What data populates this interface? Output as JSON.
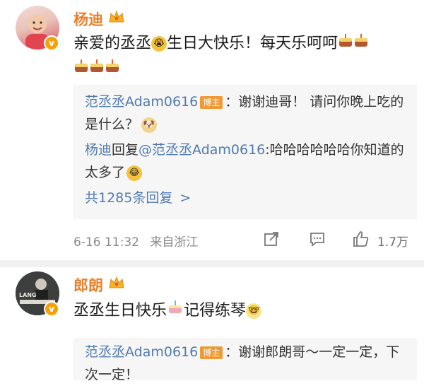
{
  "comments": [
    {
      "username": "杨迪",
      "text_a": "亲爱的丞丞",
      "text_b": "生日大快乐！每天乐呵呵",
      "replies": [
        {
          "author": "范丞丞Adam0616",
          "badge": "博主",
          "text": "：谢谢迪哥！ 请问你晚上吃的是什么？"
        },
        {
          "author": "杨迪",
          "reply_word": "回复",
          "mention": "@范丞丞Adam0616",
          "text": ":哈哈哈哈哈哈你知道的太多了"
        }
      ],
      "more_replies": "共1285条回复",
      "more_arrow": ">",
      "time": "6-16 11:32",
      "location": "来自浙江",
      "likes": "1.7万"
    },
    {
      "username": "郎朗",
      "text_a": "丞丞生日快乐",
      "text_b": "记得练琴",
      "replies": [
        {
          "author": "范丞丞Adam0616",
          "badge": "博主",
          "text": "：谢谢郎朗哥～一定一定，下次一定！"
        }
      ]
    }
  ],
  "colors": {
    "name": "#e9802b",
    "link": "#4f7ab2",
    "badge": "#f09a35",
    "meta": "#8a8a8a",
    "reply_bg": "#f6f6f6"
  },
  "icons": [
    "crown-icon",
    "verified-badge-icon",
    "cake-emoji",
    "share-icon",
    "comment-icon",
    "like-icon"
  ]
}
